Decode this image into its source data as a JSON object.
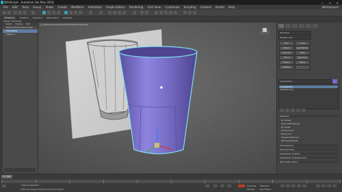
{
  "title": "MAXScript - Autodesk 3ds Max 2018",
  "window_controls": "— ☐ ✕",
  "menus": [
    "File",
    "Edit",
    "Tools",
    "Group",
    "Views",
    "Create",
    "Modifiers",
    "Animation",
    "Graph Editors",
    "Rendering",
    "Civil View",
    "Customize",
    "Scripting",
    "Content",
    "Arnold",
    "Help"
  ],
  "workspaces_label": "Workspaces:",
  "ribbon_tabs": [
    "Modeling",
    "Freeform",
    "Selection",
    "Object Paint",
    "Populate"
  ],
  "ribbon_sub": "Polygon Modeling",
  "scene_explorer": {
    "tabs": [
      "Select",
      "Display",
      "Edit"
    ],
    "header": "Name (Sorted Ascending)",
    "items": [
      "ScaleGlass",
      "Pigtalica"
    ]
  },
  "viewport": {
    "label": "[+] [Perspective] [Standard] [Default Shading]"
  },
  "command_panel": {
    "category_dropdown": "Standard",
    "category2_dropdown": "Modifier List",
    "buttons": [
      "Box",
      "Cone",
      "Sphere",
      "GeoSphere",
      "Cylinder",
      "Tube",
      "Torus",
      "Pyramid",
      "Teapot",
      "Plane",
      "TextPlus",
      ""
    ],
    "object_name": "Cylinder001",
    "stack": [
      "Cylinder001",
      "Editable Poly"
    ],
    "rollouts": [
      "Selection",
      "Soft Selection",
      "Edit Geometry",
      "Subdivision Surface",
      "Subdivision Displacement",
      "Paint Deformation"
    ],
    "selection_lines": [
      "By Vertex",
      "Ignore Backfacing",
      "By Angle",
      "Shrink   Grow",
      "Ring   Loop",
      "Preview Selection",
      "Off   SubObj   Multi"
    ]
  },
  "timeline": {
    "slider": "0 / 100",
    "ticks": [
      0,
      10,
      20,
      30,
      40,
      50,
      60,
      70,
      80,
      90,
      100
    ]
  },
  "status": {
    "line1": "1 Object Selected",
    "line2": "Click and drag to select and move objects",
    "maxscript": "MAXScript Mi",
    "auto_key": "Auto Key",
    "set_key": "Set Key",
    "selected": "Selected",
    "key_filters": "Key Filters..."
  },
  "colors": {
    "glass_color": "#8a7fd6",
    "selection_outline": "#7fe0f0",
    "viewport_bg": "#606060"
  }
}
